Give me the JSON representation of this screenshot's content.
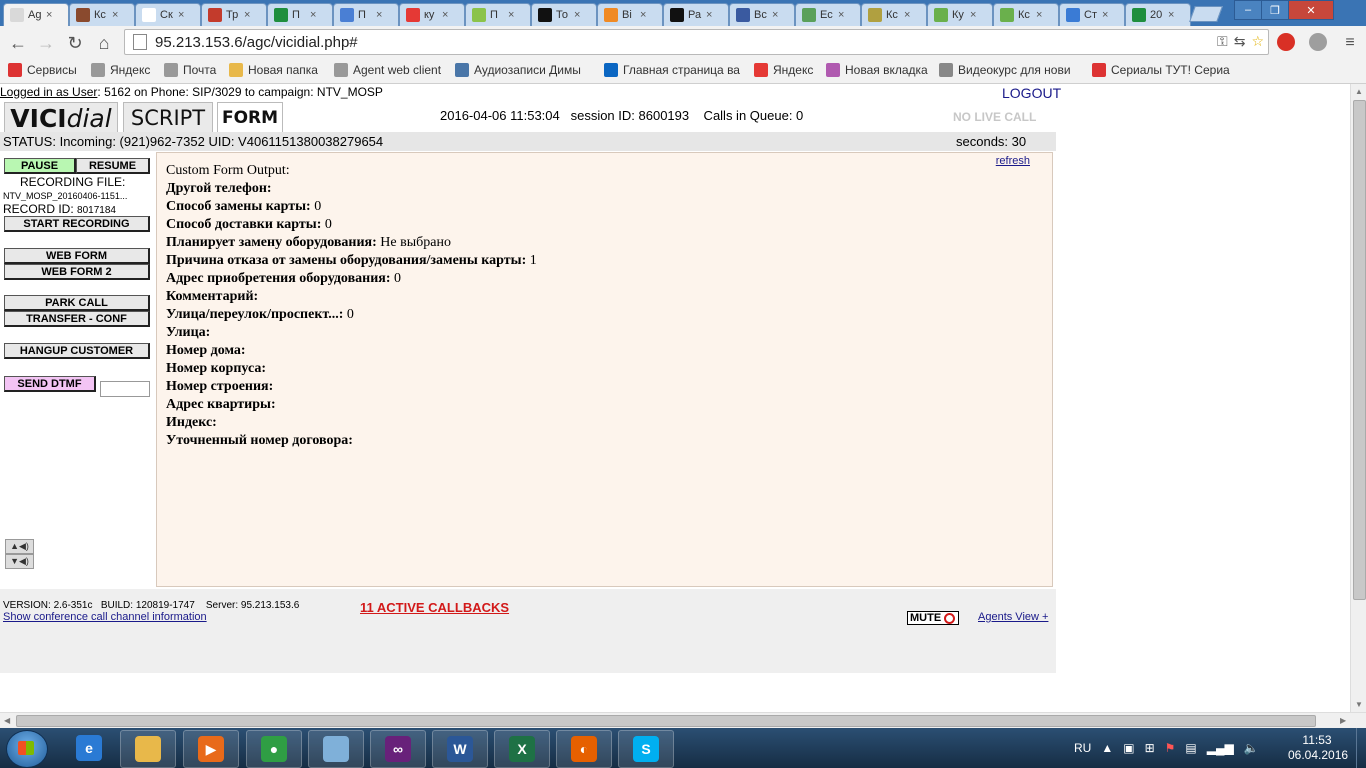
{
  "browser": {
    "tabs": [
      {
        "title": "Ag",
        "color": "#d9d9d9"
      },
      {
        "title": "Кс",
        "color": "#8a4a2e"
      },
      {
        "title": "Ск",
        "color": "#ffffff"
      },
      {
        "title": "Тр",
        "color": "#c33b2c"
      },
      {
        "title": "П",
        "color": "#1e8e3e"
      },
      {
        "title": "П",
        "color": "#4a7fd4"
      },
      {
        "title": "ку",
        "color": "#e53935"
      },
      {
        "title": "П",
        "color": "#8bc34a"
      },
      {
        "title": "То",
        "color": "#111111"
      },
      {
        "title": "Bi",
        "color": "#f08a24"
      },
      {
        "title": "Ра",
        "color": "#111111"
      },
      {
        "title": "Вс",
        "color": "#3a5aa0"
      },
      {
        "title": "Ес",
        "color": "#5aa05a"
      },
      {
        "title": "Кс",
        "color": "#b0a040"
      },
      {
        "title": "Ку",
        "color": "#6ab04c"
      },
      {
        "title": "Кс",
        "color": "#6ab04c"
      },
      {
        "title": "Ст",
        "color": "#3a7bd5"
      },
      {
        "title": "20",
        "color": "#1e8e3e"
      }
    ],
    "url": "95.213.153.6/agc/vicidial.php#",
    "bookmarks": [
      {
        "label": "Сервисы",
        "icon": "apps-icon",
        "color": "#d33"
      },
      {
        "label": "Яндекс",
        "icon": "page-icon",
        "color": "#999"
      },
      {
        "label": "Почта",
        "icon": "page-icon",
        "color": "#999"
      },
      {
        "label": "Новая папка",
        "icon": "folder-icon",
        "color": "#e8b84a"
      },
      {
        "label": "Agent web client",
        "icon": "page-icon",
        "color": "#999"
      },
      {
        "label": "Аудиозаписи Димы",
        "icon": "vk-icon",
        "color": "#4a76a8"
      },
      {
        "label": "Главная страница ва",
        "icon": "linkedin-icon",
        "color": "#0a66c2"
      },
      {
        "label": "Яндекс",
        "icon": "yandex-icon",
        "color": "#e53935"
      },
      {
        "label": "Новая вкладка",
        "icon": "flower-icon",
        "color": "#b05ab0"
      },
      {
        "label": "Видеокурс для нови",
        "icon": "ex-icon",
        "color": "#888"
      },
      {
        "label": "Сериалы ТУТ! Сериа",
        "icon": "serial-icon",
        "color": "#d33"
      }
    ]
  },
  "agent": {
    "login_prefix": "Logged in as User",
    "login_rest": ": 5162 on Phone: SIP/3029  to campaign: NTV_MOSP",
    "logout": "LOGOUT",
    "tab_script": "SCRIPT",
    "tab_form": "FORM",
    "datetime": "2016-04-06 11:53:04   session ID: 8600193    Calls in Queue: 0",
    "no_live_call": "NO LIVE CALL",
    "status": "STATUS: Incoming: (921)962-7352 UID: V4061151380038279654",
    "seconds": "seconds: 30",
    "pause": "PAUSE",
    "resume": "RESUME",
    "recording_file_label": "RECORDING FILE:",
    "recording_file_name": "NTV_MOSP_20160406-1151...",
    "record_id_label": "RECORD ID:",
    "record_id": "8017184",
    "start_recording": "START RECORDING",
    "web_form": "WEB FORM",
    "web_form_2": "WEB FORM 2",
    "park_call": "PARK CALL",
    "transfer_conf": "TRANSFER - CONF",
    "hangup_customer": "HANGUP CUSTOMER",
    "send_dtmf": "SEND DTMF",
    "dtmf_value": ""
  },
  "form": {
    "refresh": "refresh",
    "heading": "Custom Form Output:",
    "fields": [
      {
        "label": "Другой телефон:",
        "value": ""
      },
      {
        "label": "Способ замены карты:",
        "value": "0"
      },
      {
        "label": "Способ доставки карты:",
        "value": "0"
      },
      {
        "label": "Планирует замену оборудования:",
        "value": "Не выбрано"
      },
      {
        "label": "Причина отказа от замены оборудования/замены карты:",
        "value": "1"
      },
      {
        "label": "Адрес приобретения оборудования:",
        "value": "0"
      },
      {
        "label": "Комментарий:",
        "value": ""
      },
      {
        "label": "Улица/переулок/проспект...:",
        "value": "0"
      },
      {
        "label": "Улица:",
        "value": ""
      },
      {
        "label": "Номер дома:",
        "value": ""
      },
      {
        "label": "Номер корпуса:",
        "value": ""
      },
      {
        "label": "Номер строения:",
        "value": ""
      },
      {
        "label": "Адрес квартиры:",
        "value": ""
      },
      {
        "label": "Индекс:",
        "value": ""
      },
      {
        "label": "Уточненный номер договора:",
        "value": ""
      }
    ]
  },
  "footer": {
    "version": "VERSION: 2.6-351c   BUILD: 120819-1747    Server: 95.213.153.6",
    "conf_info": "Show conference call channel information",
    "callbacks": "11 ACTIVE CALLBACKS",
    "mute": "MUTE",
    "agents_view": "Agents View +"
  },
  "taskbar": {
    "apps": [
      {
        "name": "ie-icon",
        "color": "#2a7ad4",
        "glyph": "e"
      },
      {
        "name": "explorer-icon",
        "color": "#e8b84a",
        "glyph": ""
      },
      {
        "name": "media-player-icon",
        "color": "#e86a1a",
        "glyph": "▶"
      },
      {
        "name": "chrome-icon",
        "color": "#2f9e44",
        "glyph": "●"
      },
      {
        "name": "app-icon",
        "color": "#7fb0d9",
        "glyph": ""
      },
      {
        "name": "visual-studio-icon",
        "color": "#68217a",
        "glyph": "∞"
      },
      {
        "name": "word-icon",
        "color": "#2b5797",
        "glyph": "W"
      },
      {
        "name": "excel-icon",
        "color": "#1e7145",
        "glyph": "X"
      },
      {
        "name": "firefox-icon",
        "color": "#e66000",
        "glyph": "◐"
      },
      {
        "name": "skype-icon",
        "color": "#00aff0",
        "glyph": "S"
      }
    ],
    "lang": "RU",
    "time": "11:53",
    "date": "06.04.2016"
  }
}
